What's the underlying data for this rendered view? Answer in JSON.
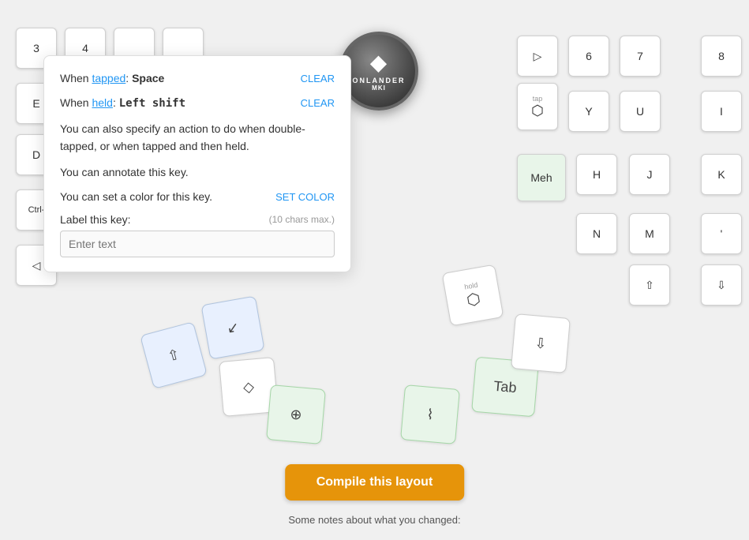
{
  "popup": {
    "tapped_label": "When ",
    "tapped_word": "tapped",
    "tapped_colon": ":",
    "tapped_key": " Space",
    "tapped_clear": "CLEAR",
    "held_label": "When ",
    "held_word": "held",
    "held_colon": ":",
    "held_key": " Left shift",
    "held_clear": "CLEAR",
    "action_text1": "You can also specify an action to do when ",
    "double_tapped_link": "double-tapped",
    "action_text2": ", or when ",
    "tapped_held_link": "tapped and then held",
    "action_text3": ".",
    "annotate_text1": "You can ",
    "annotate_link": "annotate",
    "annotate_text2": " this key.",
    "color_text": "You can set a color for this key.",
    "set_color_btn": "SET COLOR",
    "label_title": "Label this key:",
    "char_max": "(10 chars max.)",
    "input_placeholder": "Enter text"
  },
  "keys": {
    "num3": "3",
    "num4": "4",
    "num6": "6",
    "num7": "7",
    "num8": "8",
    "e_key": "E",
    "y_key": "Y",
    "u_key": "U",
    "i_key": "I",
    "d_key": "D",
    "h_key": "H",
    "j_key": "J",
    "k_key": "K",
    "ctrl_key": "Ctrl-",
    "n_key": "N",
    "m_key": "M",
    "apostrophe": "'",
    "meh_key": "Meh",
    "tab_key": "Tab",
    "tap_label": "tap"
  },
  "logo": {
    "main_text": "ONLANDER",
    "sub_text": "MKI"
  },
  "compile": {
    "button_label": "Compile this layout"
  },
  "notes": {
    "text": "Some notes about what you changed:"
  }
}
